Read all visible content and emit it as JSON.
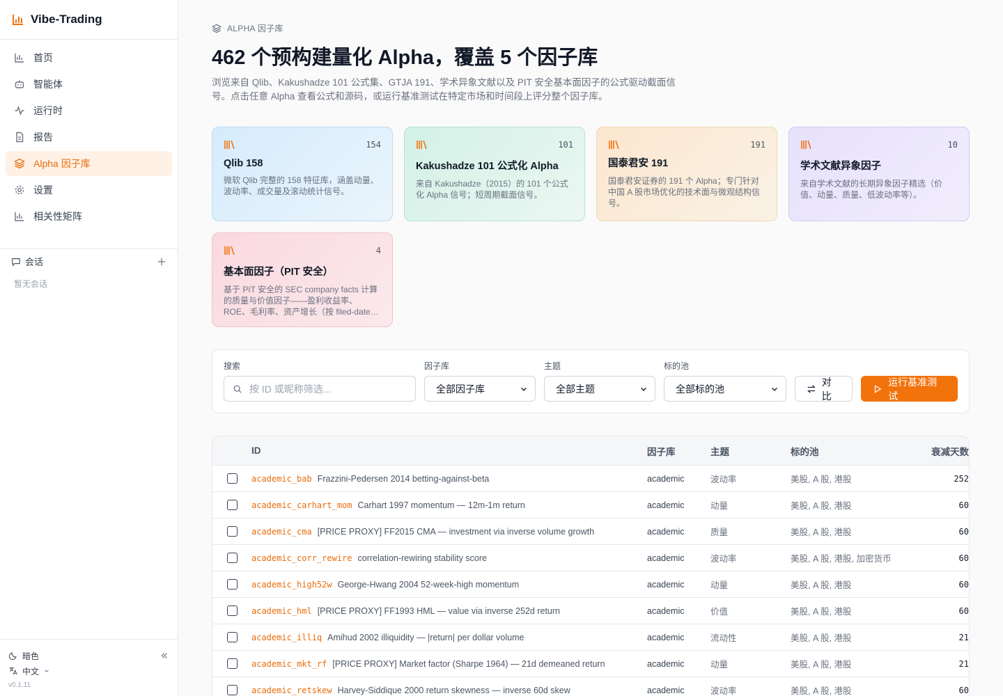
{
  "app": {
    "name": "Vibe-Trading",
    "version": "v0.1.11"
  },
  "nav": [
    {
      "label": "首页",
      "icon": "bar-chart-icon"
    },
    {
      "label": "智能体",
      "icon": "bot-icon"
    },
    {
      "label": "运行时",
      "icon": "activity-icon"
    },
    {
      "label": "报告",
      "icon": "file-icon"
    },
    {
      "label": "Alpha 因子库",
      "icon": "layers-icon",
      "active": true
    },
    {
      "label": "设置",
      "icon": "gear-icon"
    },
    {
      "label": "相关性矩阵",
      "icon": "bar-chart-icon"
    }
  ],
  "sessions": {
    "title": "会话",
    "empty": "暂无会话"
  },
  "sidebar_bottom": {
    "theme": "暗色",
    "language": "中文"
  },
  "header": {
    "eyebrow": "ALPHA 因子库",
    "title": "462 个预构建量化 Alpha，覆盖 5 个因子库",
    "description": "浏览来自 Qlib、Kakushadze 101 公式集、GTJA 191、学术异象文献以及 PIT 安全基本面因子的公式驱动截面信号。点击任意 Alpha 查看公式和源码，或运行基准测试在特定市场和时间段上评分整个因子库。"
  },
  "libraries": [
    {
      "count": "154",
      "title": "Qlib 158",
      "desc": "微软 Qlib 完整的 158 特征库，涵盖动量、波动率、成交量及滚动统计信号。"
    },
    {
      "count": "101",
      "title": "Kakushadze 101 公式化 Alpha",
      "desc": "来自 Kakushadze（2015）的 101 个公式化 Alpha 信号；短周期截面信号。"
    },
    {
      "count": "191",
      "title": "国泰君安 191",
      "desc": "国泰君安证券的 191 个 Alpha；专门针对中国 A 股市场优化的技术面与微观结构信号。"
    },
    {
      "count": "10",
      "title": "学术文献异象因子",
      "desc": "来自学术文献的长期异象因子精选（价值、动量、质量、低波动率等）。"
    },
    {
      "count": "4",
      "title": "基本面因子（PIT 安全）",
      "desc": "基于 PIT 安全的 SEC company facts 计算的质量与价值因子——盈利收益率、ROE、毛利率、资产增长（按 filed-date…"
    }
  ],
  "filters": {
    "search_label": "搜索",
    "search_placeholder": "按 ID 或昵称筛选...",
    "library_label": "因子库",
    "library_value": "全部因子库",
    "theme_label": "主题",
    "theme_value": "全部主题",
    "pool_label": "标的池",
    "pool_value": "全部标的池",
    "compare_label": "对比",
    "run_label": "运行基准测试"
  },
  "table": {
    "headers": {
      "id": "ID",
      "library": "因子库",
      "theme": "主题",
      "pool": "标的池",
      "decay": "衰减天数"
    },
    "rows": [
      {
        "id": "academic_bab",
        "name": "Frazzini-Pedersen 2014 betting-against-beta",
        "library": "academic",
        "theme": "波动率",
        "pool": "美股, A 股, 港股",
        "decay": "252"
      },
      {
        "id": "academic_carhart_mom",
        "name": "Carhart 1997 momentum — 12m-1m return",
        "library": "academic",
        "theme": "动量",
        "pool": "美股, A 股, 港股",
        "decay": "60"
      },
      {
        "id": "academic_cma",
        "name": "[PRICE PROXY] FF2015 CMA — investment via inverse volume growth",
        "library": "academic",
        "theme": "质量",
        "pool": "美股, A 股, 港股",
        "decay": "60"
      },
      {
        "id": "academic_corr_rewire",
        "name": "correlation-rewiring stability score",
        "library": "academic",
        "theme": "波动率",
        "pool": "美股, A 股, 港股, 加密货币",
        "decay": "60"
      },
      {
        "id": "academic_high52w",
        "name": "George-Hwang 2004 52-week-high momentum",
        "library": "academic",
        "theme": "动量",
        "pool": "美股, A 股, 港股",
        "decay": "60"
      },
      {
        "id": "academic_hml",
        "name": "[PRICE PROXY] FF1993 HML — value via inverse 252d return",
        "library": "academic",
        "theme": "价值",
        "pool": "美股, A 股, 港股",
        "decay": "60"
      },
      {
        "id": "academic_illiq",
        "name": "Amihud 2002 illiquidity — |return| per dollar volume",
        "library": "academic",
        "theme": "流动性",
        "pool": "美股, A 股, 港股",
        "decay": "21"
      },
      {
        "id": "academic_mkt_rf",
        "name": "[PRICE PROXY] Market factor (Sharpe 1964) — 21d demeaned return",
        "library": "academic",
        "theme": "动量",
        "pool": "美股, A 股, 港股",
        "decay": "21"
      },
      {
        "id": "academic_retskew",
        "name": "Harvey-Siddique 2000 return skewness — inverse 60d skew",
        "library": "academic",
        "theme": "波动率",
        "pool": "美股, A 股, 港股",
        "decay": "60"
      }
    ]
  },
  "colors": {
    "accent": "#f2720c",
    "accent_text": "#ea6c0a"
  }
}
